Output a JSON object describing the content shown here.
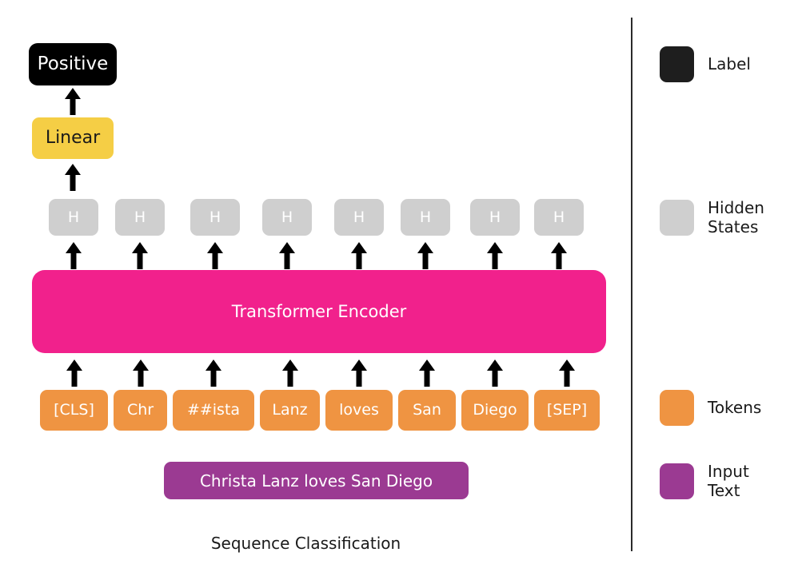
{
  "figure": {
    "caption": "Sequence Classification",
    "colors": {
      "label": "#000000",
      "linear": "#F5CE45",
      "hidden": "#CFCFCF",
      "encoder": "#F1218C",
      "token": "#EF9442",
      "input_text": "#9B3A92",
      "background": "#FFFFFF",
      "divider": "#2B2B2B"
    }
  },
  "label": {
    "text": "Positive"
  },
  "linear": {
    "text": "Linear"
  },
  "hidden_states": {
    "items": [
      {
        "text": "H"
      },
      {
        "text": "H"
      },
      {
        "text": "H"
      },
      {
        "text": "H"
      },
      {
        "text": "H"
      },
      {
        "text": "H"
      },
      {
        "text": "H"
      },
      {
        "text": "H"
      }
    ]
  },
  "encoder": {
    "text": "Transformer Encoder"
  },
  "tokens": {
    "items": [
      {
        "text": "[CLS]"
      },
      {
        "text": "Chr"
      },
      {
        "text": "##ista"
      },
      {
        "text": "Lanz"
      },
      {
        "text": "loves"
      },
      {
        "text": "San"
      },
      {
        "text": "Diego"
      },
      {
        "text": "[SEP]"
      }
    ]
  },
  "input_text": {
    "text": "Christa Lanz loves San Diego"
  },
  "legend": {
    "items": [
      {
        "label": "Label",
        "color": "#1E1E1E"
      },
      {
        "label": "Hidden\nStates",
        "color": "#CFCFCF"
      },
      {
        "label": "Tokens",
        "color": "#EF9442"
      },
      {
        "label": "Input\nText",
        "color": "#9B3A92"
      }
    ]
  }
}
